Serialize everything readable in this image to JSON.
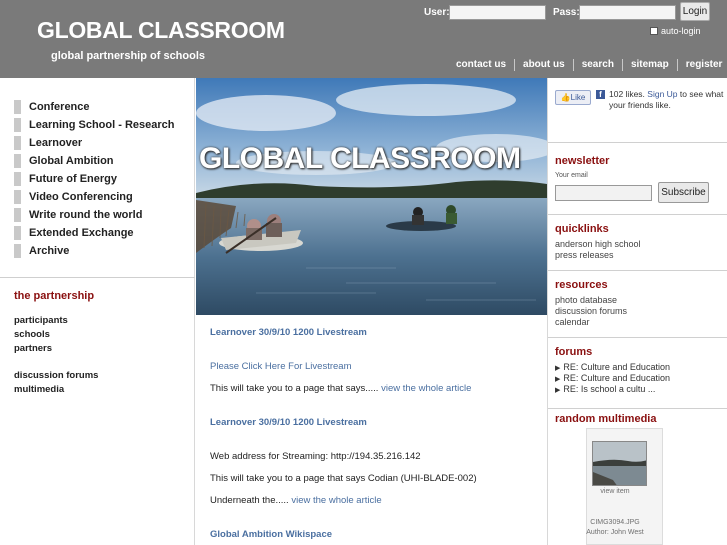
{
  "header": {
    "title": "GLOBAL CLASSROOM",
    "tagline": "global partnership of schools",
    "login": {
      "user_label": "User:",
      "pass_label": "Pass:",
      "button": "Login",
      "autologin_label": "auto-login"
    },
    "nav": [
      "contact us",
      "about us",
      "search",
      "sitemap",
      "register"
    ]
  },
  "sidebar": {
    "menu": [
      "Conference",
      "Learning School - Research",
      "Learnover",
      "Global Ambition",
      "Future of Energy",
      "Video Conferencing",
      "Write round the world",
      "Extended Exchange",
      "Archive"
    ],
    "partnership_title": "the partnership",
    "partnership_links": [
      "participants",
      "schools",
      "partners"
    ],
    "other_links": [
      "discussion forums",
      "multimedia"
    ]
  },
  "hero": {
    "text": "GLOBAL CLASSROOM",
    "colors": {
      "sky": "#5c8fc2",
      "water": "#4c6f8e"
    }
  },
  "articles": [
    {
      "title": "Learnover 30/9/10 1200 Livestream",
      "link": "Please Click Here For Livestream",
      "text": "This will take you to a page that says.....",
      "more": "view the whole article"
    },
    {
      "title": "Learnover 30/9/10 1200 Livestream",
      "line1": "Web address for Streaming: http://194.35.216.142",
      "line2": "This will take you to a page that says Codian (UHI-BLADE-002)",
      "text": "Underneath the.....",
      "more": "view the whole article"
    },
    {
      "title": "Global Ambition Wikispace"
    }
  ],
  "right": {
    "facebook": {
      "like_label": "Like",
      "count_text": "102 likes.",
      "signup": "Sign Up",
      "rest": "to see what your friends like."
    },
    "newsletter": {
      "title": "newsletter",
      "email_label": "Your email",
      "button": "Subscribe"
    },
    "quicklinks": {
      "title": "quicklinks",
      "items": [
        "anderson high school",
        "press releases"
      ]
    },
    "resources": {
      "title": "resources",
      "items": [
        "photo database",
        "discussion forums",
        "calendar"
      ]
    },
    "forums": {
      "title": "forums",
      "items": [
        "RE: Culture and Education",
        "RE: Culture and Education",
        "RE: Is school a cultu ..."
      ]
    },
    "random_multimedia": {
      "title": "random multimedia",
      "view_label": "view item",
      "filename": "CIMG3094.JPG",
      "author": "Author: John West"
    }
  },
  "colors": {
    "header_bg": "#7a7a7a",
    "section_title": "#8a1010",
    "link": "#4a6fa0"
  }
}
